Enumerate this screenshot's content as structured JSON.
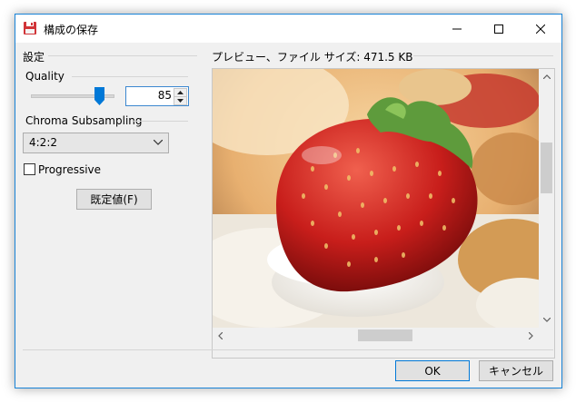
{
  "window": {
    "title": "構成の保存",
    "icon": "floppy-disk-icon",
    "controls": [
      "minimize-icon",
      "maximize-icon",
      "close-icon"
    ]
  },
  "settings": {
    "group_label": "設定",
    "quality": {
      "label": "Quality",
      "value": "85",
      "slider_fraction": 0.85
    },
    "chroma": {
      "label": "Chroma Subsampling",
      "selected": "4:2:2"
    },
    "progressive": {
      "label": "Progressive",
      "checked": false
    },
    "default_button": "既定値(F)"
  },
  "preview": {
    "label": "プレビュー、ファイル サイズ: 471.5 KB",
    "image": "strawberry-on-cream-photo"
  },
  "footer": {
    "ok_label": "OK",
    "cancel_label": "キャンセル"
  },
  "colors": {
    "accent": "#0078d7",
    "titlebar": "#ffffff",
    "dialog_bg": "#f0f0f0",
    "slider_thumb": "#0078d7"
  }
}
